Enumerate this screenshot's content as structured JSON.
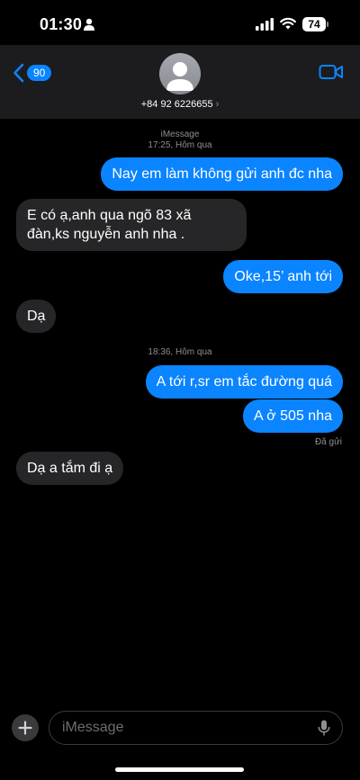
{
  "status_bar": {
    "time": "01:30",
    "battery": "74"
  },
  "header": {
    "back_badge": "90",
    "contact": "+84 92 6226655",
    "chevron": "›"
  },
  "thread": {
    "service_label": "iMessage",
    "time1": "17:25, Hôm qua",
    "time2": "18:36, Hôm qua",
    "messages": [
      "Nay em làm không gửi anh đc nha",
      "E có ạ,anh qua ngõ 83 xã đàn,ks nguyễn anh nha .",
      "Oke,15’ anh tới",
      "Dạ",
      "A tới r,sr em tắc đường quá",
      "A ở 505 nha",
      "Dạ a tắm đi ạ"
    ],
    "delivered": "Đã gửi"
  },
  "composer": {
    "placeholder": "iMessage"
  },
  "icons": [
    "person-icon",
    "signal-icon",
    "wifi-icon",
    "battery-icon",
    "back-chevron-icon",
    "avatar-icon",
    "video-camera-icon",
    "plus-icon",
    "microphone-icon"
  ],
  "colors": {
    "outgoing": "#0a84ff",
    "incoming": "#262628",
    "header": "#1c1c1e",
    "background": "#000000"
  }
}
